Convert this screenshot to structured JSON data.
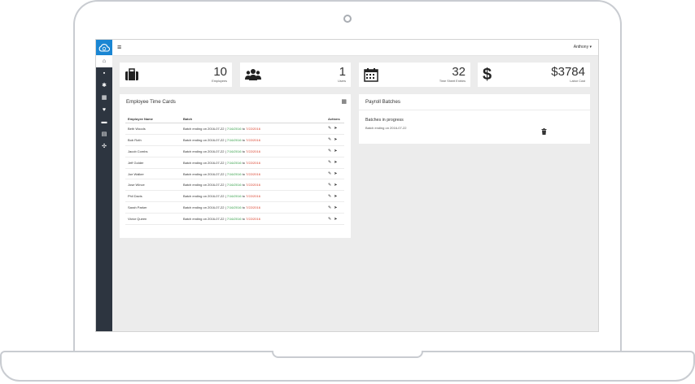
{
  "topbar": {
    "user": "Anthony"
  },
  "stats": [
    {
      "value": "10",
      "label": "Employees",
      "icon": "briefcase-icon"
    },
    {
      "value": "1",
      "label": "Users",
      "icon": "users-icon"
    },
    {
      "value": "32",
      "label": "Time Sheet Entries",
      "icon": "calendar-icon"
    },
    {
      "value": "$3784",
      "label": "Labor Cost",
      "icon": "dollar-icon"
    }
  ],
  "timecards": {
    "title": "Employee Time Cards",
    "headers": {
      "name": "Employee Name",
      "batch": "Batch",
      "actions": "Actions"
    },
    "batch_prefix": "Batch ending on 2016-07-22 |",
    "start": "7/16/2016",
    "to": "to",
    "end": "7/22/2016",
    "rows": [
      "Beth Woods",
      "Bob Roth",
      "Jacob Combs",
      "Jeff Golder",
      "Joe Walker",
      "Jose Wince",
      "Phil Davis",
      "Sarah Parker",
      "Victor Queen"
    ]
  },
  "payroll": {
    "title": "Payroll Batches",
    "section": "Batches in progress",
    "item": "Batch ending on 2016-07-22"
  },
  "colors": {
    "accent": "#1a86d3",
    "sidebar": "#2d3540",
    "start_date": "#2e9b42",
    "end_date": "#d9402b"
  }
}
